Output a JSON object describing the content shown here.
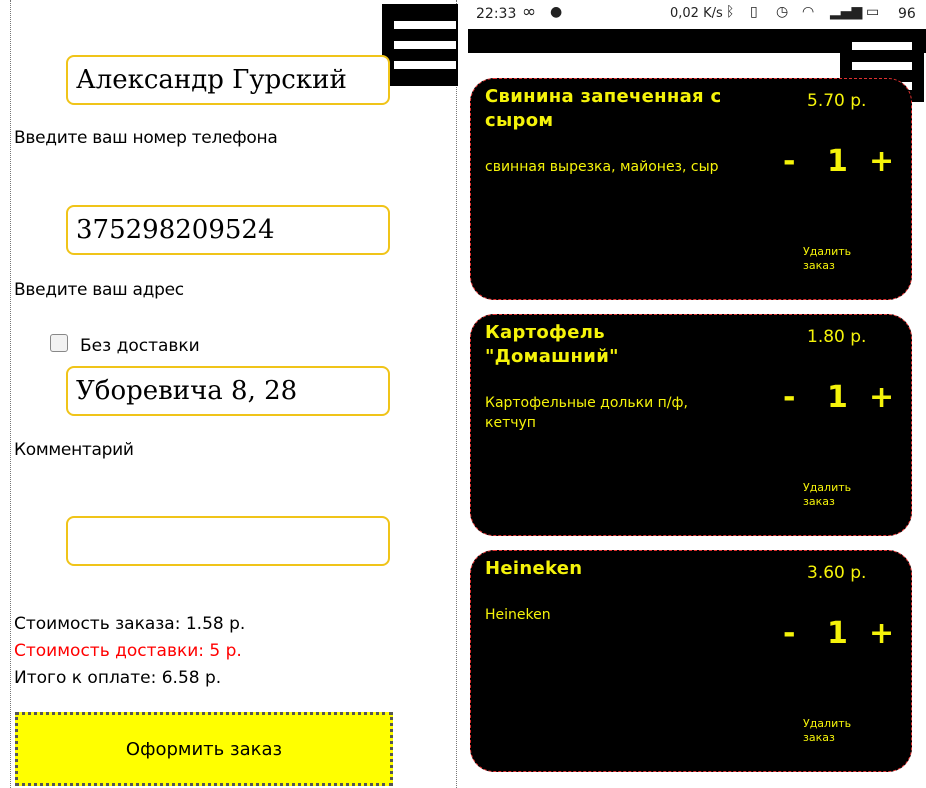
{
  "form": {
    "name_value": "Александр Гурский",
    "phone_label": "Введите ваш номер телефона",
    "phone_value": "375298209524",
    "address_label": "Введите ваш адрес",
    "no_delivery_label": "Без доставки",
    "address_value": "Уборевича 8, 28",
    "comment_label": "Комментарий",
    "comment_value": ""
  },
  "totals": {
    "order_cost": "Стоимость заказа: 1.58 р.",
    "delivery_cost": "Стоимость доставки: 5 р.",
    "total": "Итого к оплате: 6.58 р."
  },
  "order_button_label": "Оформить заказ",
  "status_bar": {
    "time": "22:33",
    "net_speed": "0,02 K/s",
    "battery": "96"
  },
  "cart": [
    {
      "title": "Свинина запеченная с сыром",
      "price": "5.70 р.",
      "description": "свинная вырезка, майонез, сыр",
      "minus": "-",
      "qty": "1",
      "plus": "+",
      "remove": "Удалить заказ"
    },
    {
      "title": "Картофель \"Домашний\"",
      "price": "1.80 р.",
      "description": "Картофельные дольки п/ф, кетчуп",
      "minus": "-",
      "qty": "1",
      "plus": "+",
      "remove": "Удалить заказ"
    },
    {
      "title": "Heineken",
      "price": "3.60 р.",
      "description": "Heineken",
      "minus": "-",
      "qty": "1",
      "plus": "+",
      "remove": "Удалить заказ"
    }
  ],
  "colors": {
    "accent": "#f5f30a",
    "field_border": "#f0c419",
    "button_bg": "#ffff00",
    "delivery_red": "#ff0000"
  },
  "icons": [
    "menu-icon",
    "infinity-icon",
    "chat-icon",
    "bluetooth-icon",
    "vibrate-icon",
    "alarm-icon",
    "wifi-icon",
    "signal-icon",
    "battery-icon"
  ]
}
